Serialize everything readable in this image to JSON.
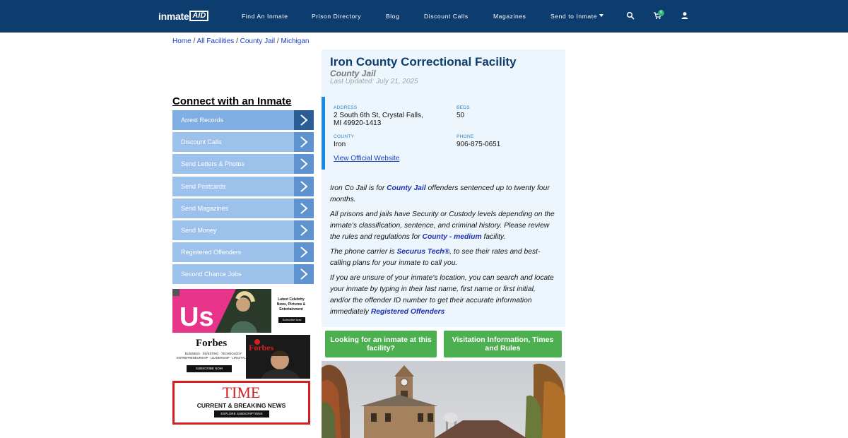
{
  "header": {
    "logo_text": "inmate",
    "logo_badge": "AID",
    "nav": [
      {
        "label": "Find An Inmate"
      },
      {
        "label": "Prison Directory"
      },
      {
        "label": "Blog"
      },
      {
        "label": "Discount Calls"
      },
      {
        "label": "Magazines"
      },
      {
        "label": "Send to Inmate"
      }
    ],
    "cart_count": "0"
  },
  "breadcrumb": {
    "items": [
      "Home",
      "All Facilities",
      "County Jail",
      "Michigan"
    ],
    "separator": "/"
  },
  "sidebar": {
    "title": "Connect with an Inmate",
    "items": [
      {
        "label": "Arrest Records"
      },
      {
        "label": "Discount Calls"
      },
      {
        "label": "Send Letters & Photos"
      },
      {
        "label": "Send Postcards"
      },
      {
        "label": "Send Magazines"
      },
      {
        "label": "Send Money"
      },
      {
        "label": "Registered Offenders"
      },
      {
        "label": "Second Chance Jobs"
      }
    ]
  },
  "ads": {
    "us": {
      "brand": "Us",
      "tagline": "Latest Celebrity News, Pictures & Entertainment",
      "cta": "Subscribe Now"
    },
    "forbes": {
      "brand": "Forbes",
      "tagline1": "BUSINESS · INVESTING · TECHNOLOGY",
      "tagline2": "ENTREPRENEURSHIP · LEADERSHIP · LIFESTYLE",
      "cta": "SUBSCRIBE NOW"
    },
    "time": {
      "brand": "TIME",
      "tagline": "CURRENT & BREAKING NEWS",
      "cta": "EXPLORE SUBSCRIPTIONS"
    }
  },
  "facility": {
    "name": "Iron County Correctional Facility",
    "type": "County Jail",
    "updated": "Last Updated: July 21, 2025",
    "address_label": "ADDRESS",
    "address_line1": "2 South 6th St, Crystal Falls,",
    "address_line2": "MI 49920-1413",
    "beds_label": "BEDS",
    "beds": "50",
    "county_label": "COUNTY",
    "county": "Iron",
    "phone_label": "PHONE",
    "phone": "906-875-0651",
    "website_label": "View Official Website"
  },
  "description": {
    "p1_a": "Iron Co Jail is for ",
    "p1_link": "County Jail",
    "p1_b": " offenders sentenced up to twenty four months.",
    "p2_a": "All prisons and jails have Security or Custody levels depending on the inmate's classification, sentence, and criminal history. Please review the rules and regulations for ",
    "p2_link": "County - medium",
    "p2_b": " facility.",
    "p3_a": "The phone carrier is ",
    "p3_link": "Securus Tech®",
    "p3_b": ", to see their rates and best-calling plans for your inmate to call you.",
    "p4_a": "If you are unsure of your inmate's location, you can search and locate your inmate by typing in their last name, first name or first initial, and/or the offender ID number to get their accurate information immediately",
    "p4_link": "Registered Offenders"
  },
  "buttons": {
    "looking": "Looking for an inmate at this facility?",
    "visitation": "Visitation Information, Times and Rules"
  },
  "colors": {
    "header_bg": "#0d3d6e",
    "link": "#1a40c0",
    "green": "#4caf50",
    "panel_bg": "#eef6fd",
    "accent_bar": "#1e88e5"
  }
}
